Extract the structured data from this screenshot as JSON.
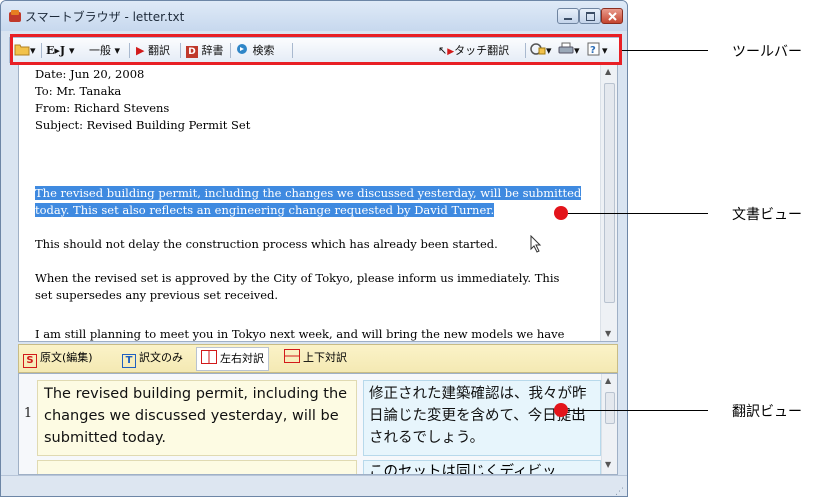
{
  "window": {
    "title": "スマートブラウザ - letter.txt"
  },
  "toolbar": {
    "direction": "E▸J ▾",
    "category": "一般 ▾",
    "translate": "翻訳",
    "dictionary": "辞書",
    "search": "検索",
    "touch_translate": "タッチ翻訳"
  },
  "document": {
    "lines": [
      "Date: Jun 20, 2008",
      "To: Mr. Tanaka",
      "From: Richard Stevens",
      "Subject: Revised Building Permit Set",
      "The revised building permit, including the changes we discussed yesterday, will be submitted",
      "today. This set also reflects an engineering change requested by David Turner.",
      "This should not delay the construction process which has already been started.",
      "When the revised set is approved by the City of Tokyo, please inform us immediately. This",
      "set supersedes any previous set received.",
      "I am still planning to meet you in Tokyo next week, and will bring the new models we have"
    ]
  },
  "view_tabs": {
    "source_edit": "原文(編集)",
    "translation_only": "訳文のみ",
    "side_by_side": "左右対訳",
    "top_bottom": "上下対訳"
  },
  "translation_view": {
    "row_number": "1",
    "source_text": "The revised building permit, including the changes we discussed yesterday, will be submitted today.",
    "target_text": "修正された建築確認は、我々が昨日論じた変更を含めて、今日提出されるでしょう。",
    "next_target_partial": "このセットは同じくディビッ"
  },
  "callouts": {
    "toolbar": "ツールバー",
    "document_view": "文書ビュー",
    "translation_view": "翻訳ビュー"
  },
  "colors": {
    "callout_red": "#e81f25",
    "selection_blue": "#3f8ae0"
  }
}
